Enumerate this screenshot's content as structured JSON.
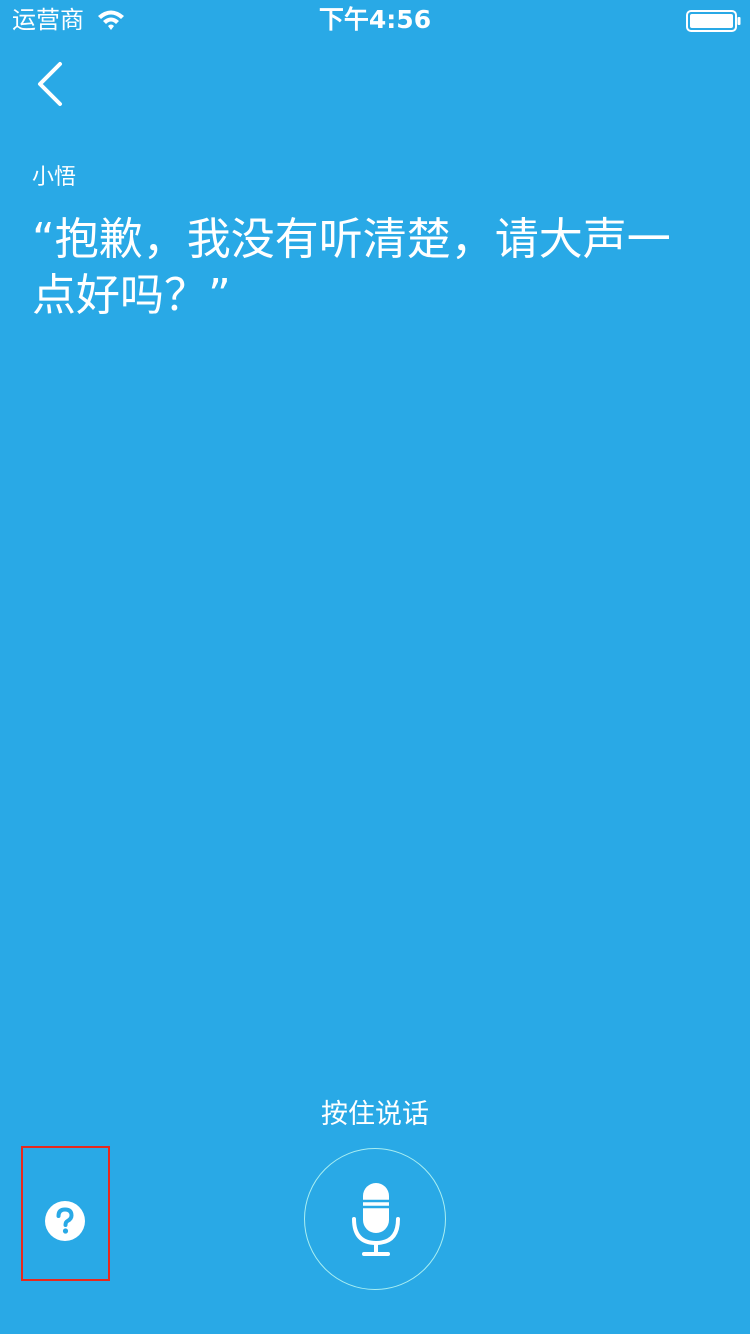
{
  "status_bar": {
    "carrier": "运营商",
    "time": "下午4:56"
  },
  "assistant": {
    "name": "小悟",
    "reply": "“抱歉，我没有听清楚，请大声一点好吗？”"
  },
  "controls": {
    "hold_to_talk_label": "按住说话",
    "mic_icon": "microphone-icon",
    "help_icon": "question-mark-icon",
    "back_icon": "chevron-left-icon"
  },
  "colors": {
    "background": "#29a9e6",
    "text": "#ffffff",
    "highlight_border": "#e8281d",
    "mic_ring": "#a8eef2"
  }
}
